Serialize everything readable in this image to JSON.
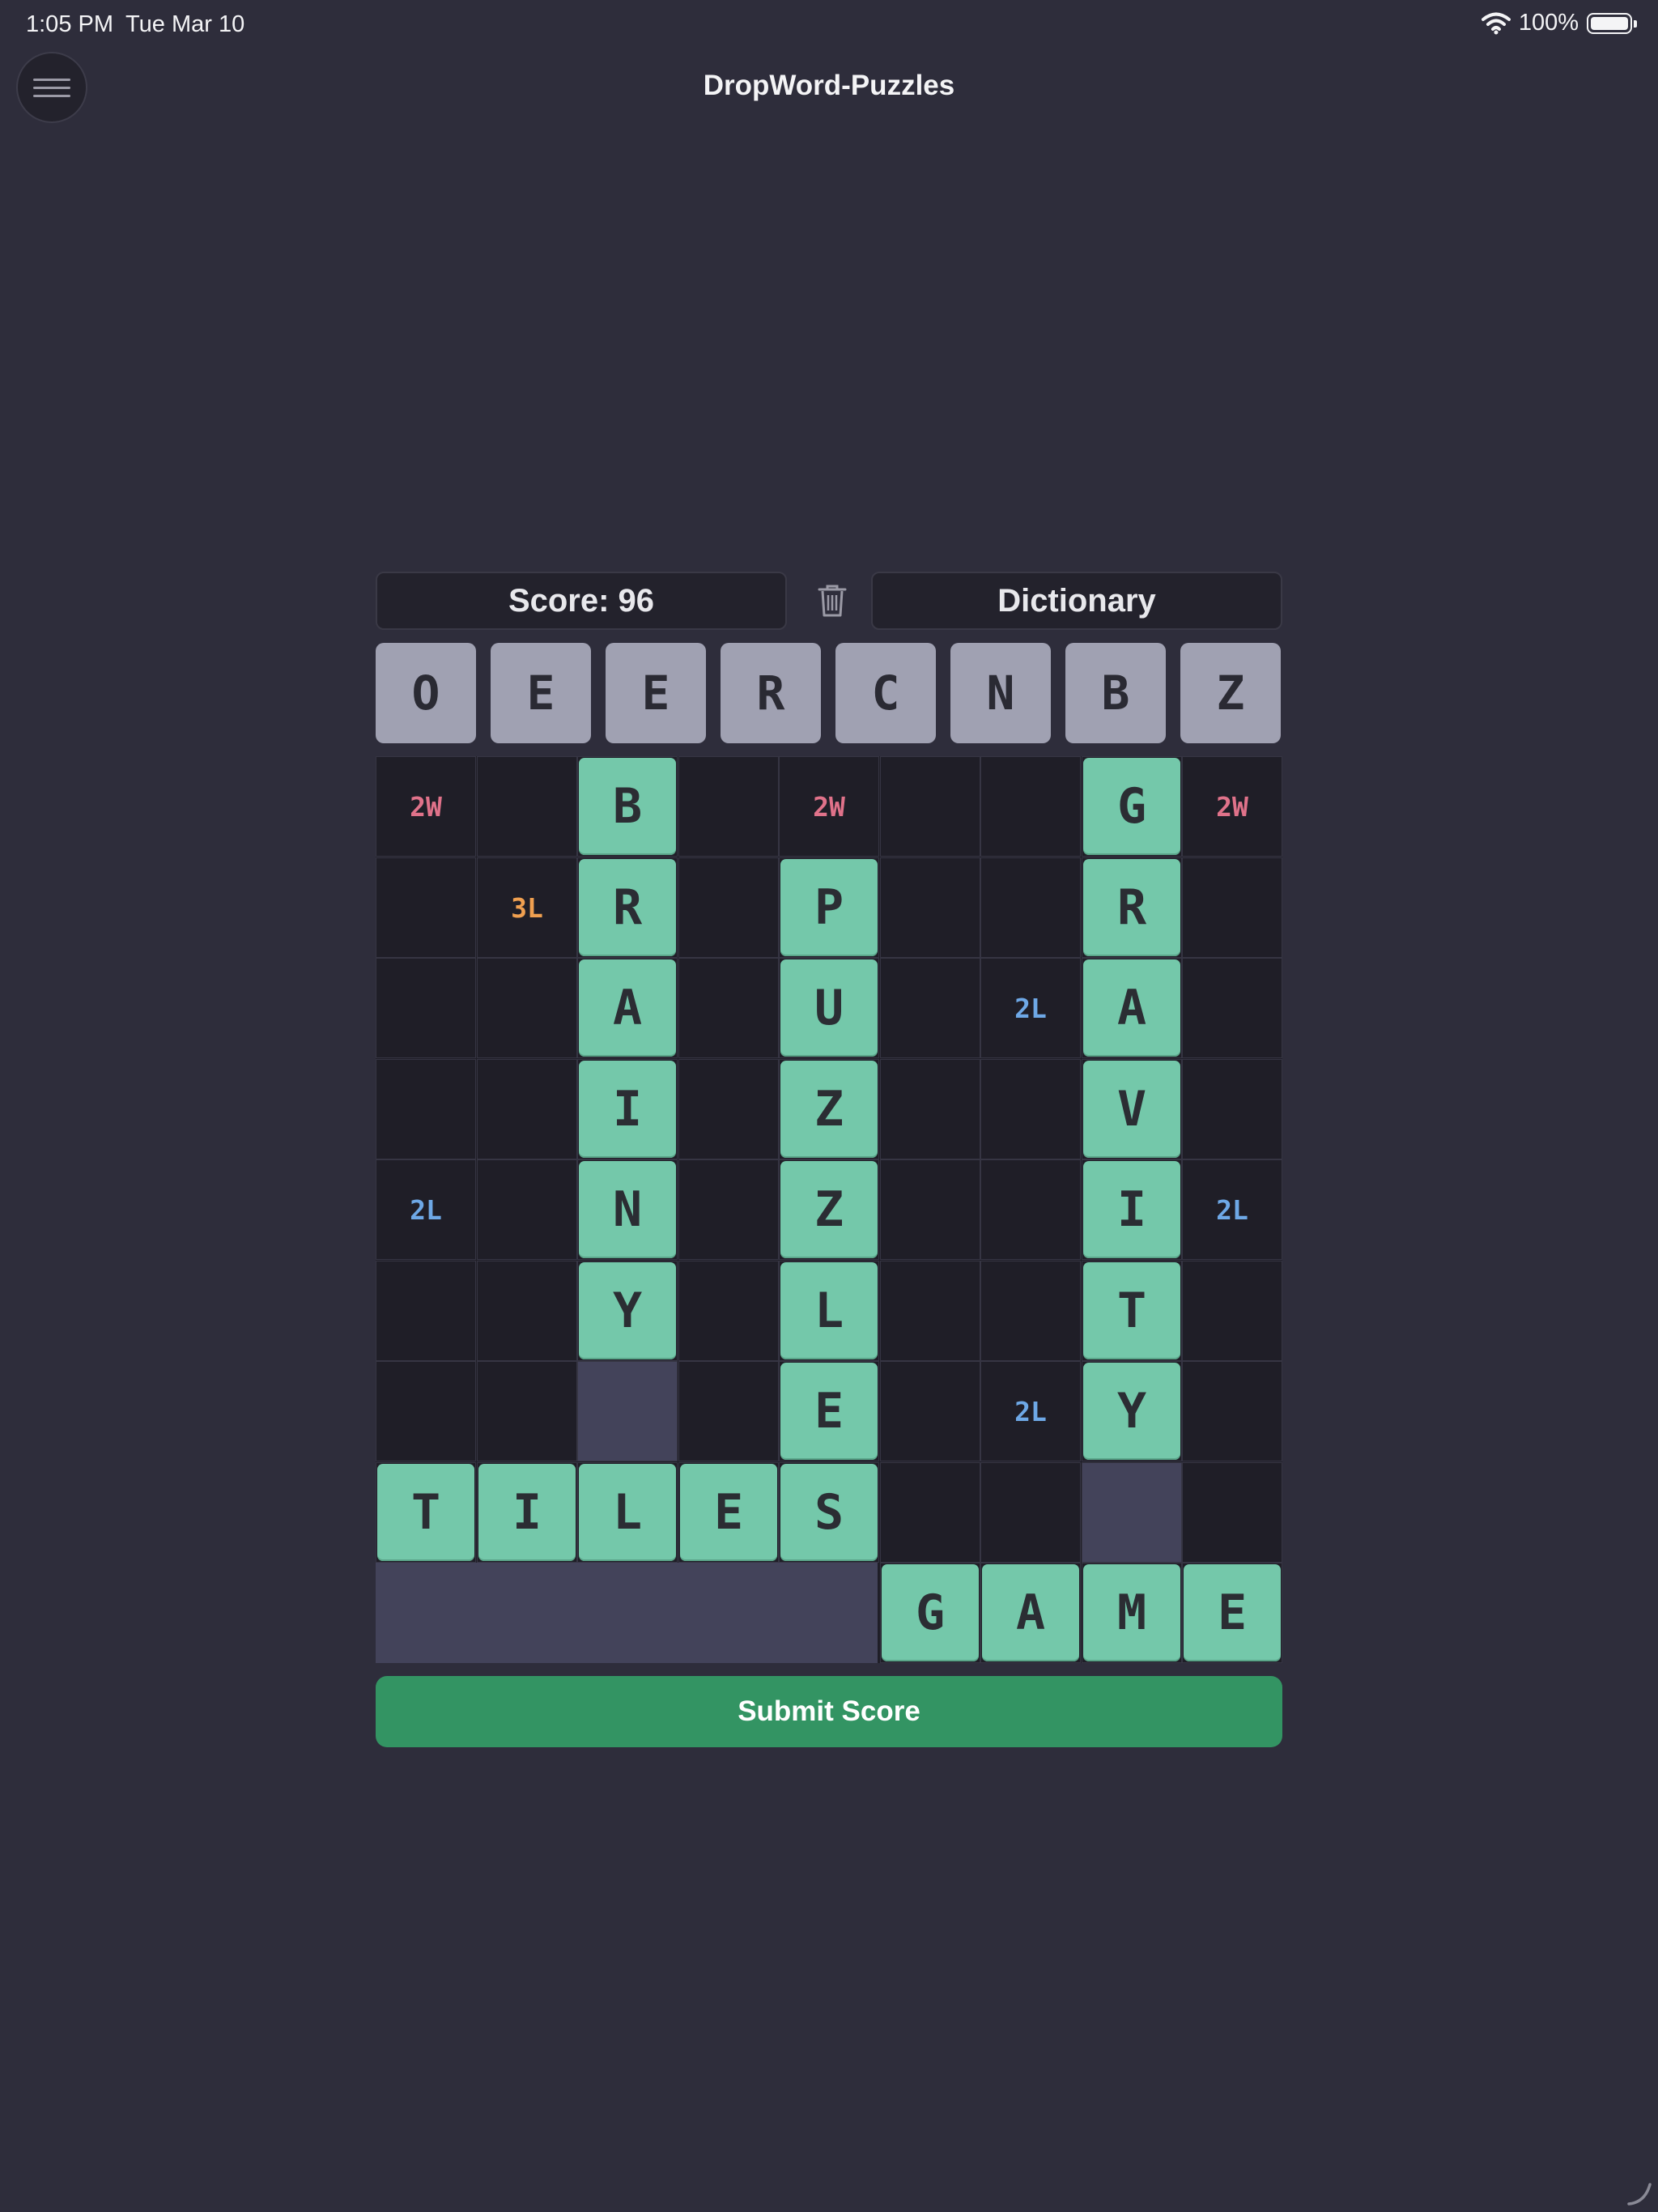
{
  "status_bar": {
    "time": "1:05 PM",
    "date": "Tue Mar 10",
    "battery": "100%"
  },
  "app": {
    "title": "DropWord-Puzzles"
  },
  "toolbar": {
    "score_label": "Score: 96",
    "dictionary_label": "Dictionary"
  },
  "rack": [
    "O",
    "E",
    "E",
    "R",
    "C",
    "N",
    "B",
    "Z"
  ],
  "board": [
    [
      "2W",
      "",
      "B",
      "",
      "2W",
      "",
      "",
      "G",
      "2W"
    ],
    [
      "",
      "3L",
      "R",
      "",
      "P",
      "",
      "",
      "R",
      ""
    ],
    [
      "",
      "",
      "A",
      "",
      "U",
      "",
      "2L",
      "A",
      ""
    ],
    [
      "",
      "",
      "I",
      "",
      "Z",
      "",
      "",
      "V",
      ""
    ],
    [
      "2L",
      "",
      "N",
      "",
      "Z",
      "",
      "",
      "I",
      "2L"
    ],
    [
      "",
      "",
      "Y",
      "",
      "L",
      "",
      "",
      "T",
      ""
    ],
    [
      "",
      "",
      "_",
      "",
      "E",
      "",
      "2L",
      "Y",
      ""
    ],
    [
      "T",
      "I",
      "L",
      "E",
      "S",
      "",
      "",
      "_",
      ""
    ],
    [
      "",
      "",
      "",
      "",
      "",
      "G",
      "A",
      "M",
      "E"
    ]
  ],
  "submit": {
    "label": "Submit Score"
  },
  "colors": {
    "tile": "#74c8aa",
    "rack_tile": "#a0a1b2",
    "submit": "#339463",
    "bonus_2W": "#e0728a",
    "bonus_3L": "#f0a050",
    "bonus_2L": "#6ea8e6"
  }
}
